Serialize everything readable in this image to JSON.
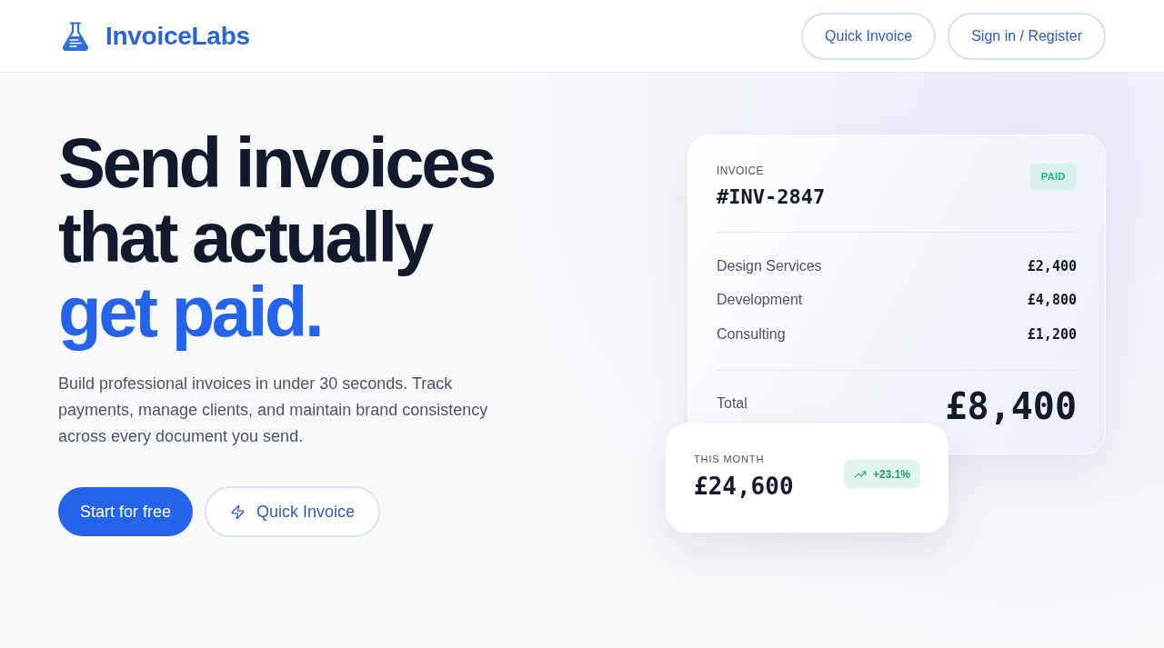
{
  "header": {
    "brand": "InvoiceLabs",
    "buttons": [
      "Quick Invoice",
      "Sign in / Register"
    ]
  },
  "hero": {
    "headline_lines": [
      {
        "text": "Send invoices",
        "accent": false
      },
      {
        "text": "that actually",
        "accent": false
      },
      {
        "text": "get paid.",
        "accent": true
      }
    ],
    "description": "Build professional invoices in under 30 seconds. Track payments, manage clients, and maintain brand consistency across every document you send.",
    "actions": [
      {
        "label": "Start for free",
        "kind": "primary"
      },
      {
        "label": "Quick Invoice",
        "kind": "secondary"
      }
    ]
  },
  "invoice_card": {
    "label": "INVOICE",
    "number": "#INV-2847",
    "status": "PAID",
    "line_items": [
      {
        "name": "Design Services",
        "amount": "£2,400"
      },
      {
        "name": "Development",
        "amount": "£4,800"
      },
      {
        "name": "Consulting",
        "amount": "£1,200"
      }
    ],
    "total_label": "Total",
    "total": "£8,400"
  },
  "stat_card": {
    "label": "THIS MONTH",
    "value": "£24,600",
    "change": "+23.1%"
  }
}
